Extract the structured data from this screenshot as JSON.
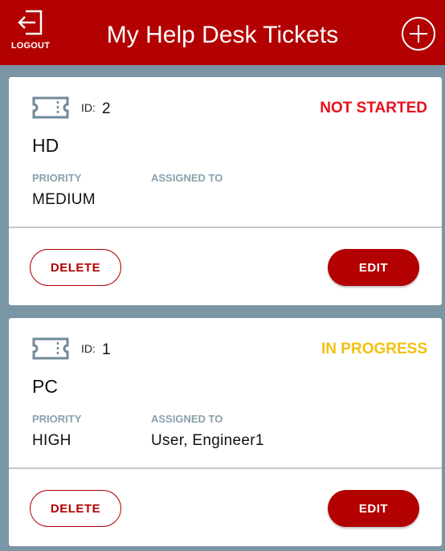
{
  "header": {
    "logout_label": "LOGOUT",
    "title": "My Help Desk Tickets",
    "add_icon": "plus-circle-icon",
    "logout_icon": "logout-icon",
    "bg_color": "#b30000"
  },
  "tickets": [
    {
      "id_label": "ID:",
      "id": "2",
      "status": "NOT STARTED",
      "status_color": "#e8101d",
      "category": "HD",
      "priority_label": "PRIORITY",
      "priority": "MEDIUM",
      "assigned_label": "ASSIGNED TO",
      "assigned_to": "",
      "delete_label": "DELETE",
      "edit_label": "EDIT",
      "icon": "ticket-icon"
    },
    {
      "id_label": "ID:",
      "id": "1",
      "status": "IN PROGRESS",
      "status_color": "#f2c10f",
      "category": "PC",
      "priority_label": "PRIORITY",
      "priority": "HIGH",
      "assigned_label": "ASSIGNED TO",
      "assigned_to": "User, Engineer1",
      "delete_label": "DELETE",
      "edit_label": "EDIT",
      "icon": "ticket-icon"
    }
  ]
}
